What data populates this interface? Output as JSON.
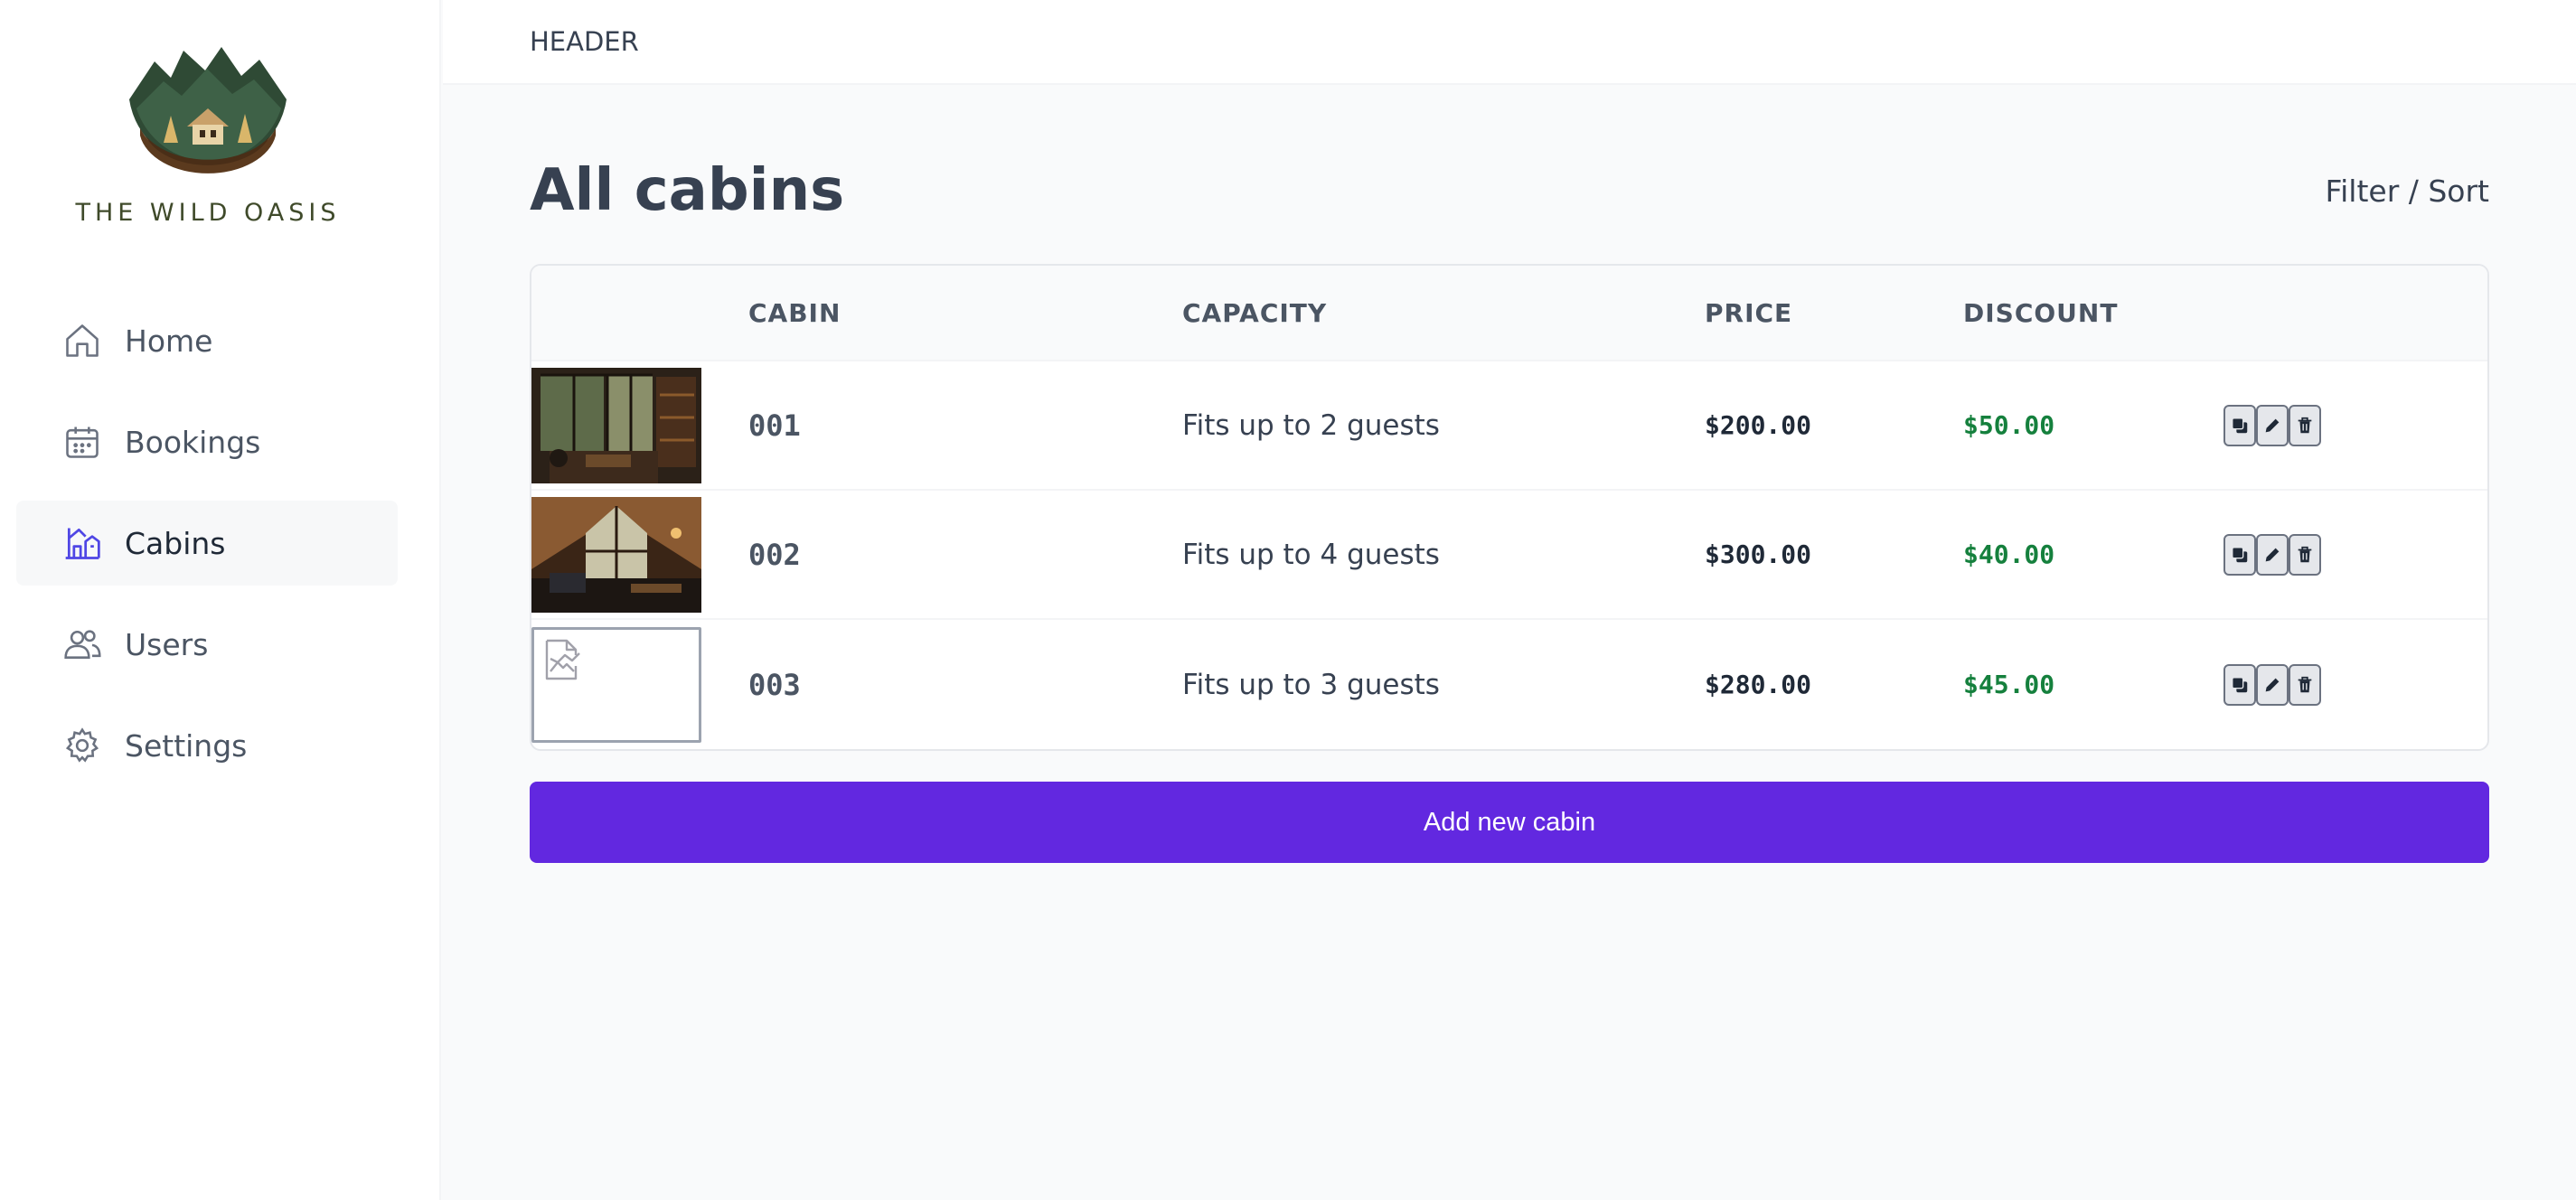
{
  "logo": {
    "text": "THE WILD OASIS"
  },
  "sidebar": {
    "items": [
      {
        "label": "Home",
        "icon": "home-icon",
        "active": false
      },
      {
        "label": "Bookings",
        "icon": "calendar-icon",
        "active": false
      },
      {
        "label": "Cabins",
        "icon": "cabin-icon",
        "active": true
      },
      {
        "label": "Users",
        "icon": "users-icon",
        "active": false
      },
      {
        "label": "Settings",
        "icon": "gear-icon",
        "active": false
      }
    ]
  },
  "header": {
    "title": "HEADER"
  },
  "main": {
    "title": "All cabins",
    "filter_sort": "Filter / Sort",
    "table": {
      "columns": [
        "",
        "CABIN",
        "CAPACITY",
        "PRICE",
        "DISCOUNT",
        ""
      ],
      "rows": [
        {
          "name": "001",
          "capacity": "Fits up to 2 guests",
          "price": "$200.00",
          "discount": "$50.00",
          "image": "cabin-photo"
        },
        {
          "name": "002",
          "capacity": "Fits up to 4 guests",
          "price": "$300.00",
          "discount": "$40.00",
          "image": "cabin-photo"
        },
        {
          "name": "003",
          "capacity": "Fits up to 3 guests",
          "price": "$280.00",
          "discount": "$45.00",
          "image": "broken-image"
        }
      ]
    },
    "add_button": "Add new cabin"
  },
  "colors": {
    "accent": "#6228e0",
    "discount": "#15803d",
    "active_nav_icon": "#4f46e5"
  }
}
